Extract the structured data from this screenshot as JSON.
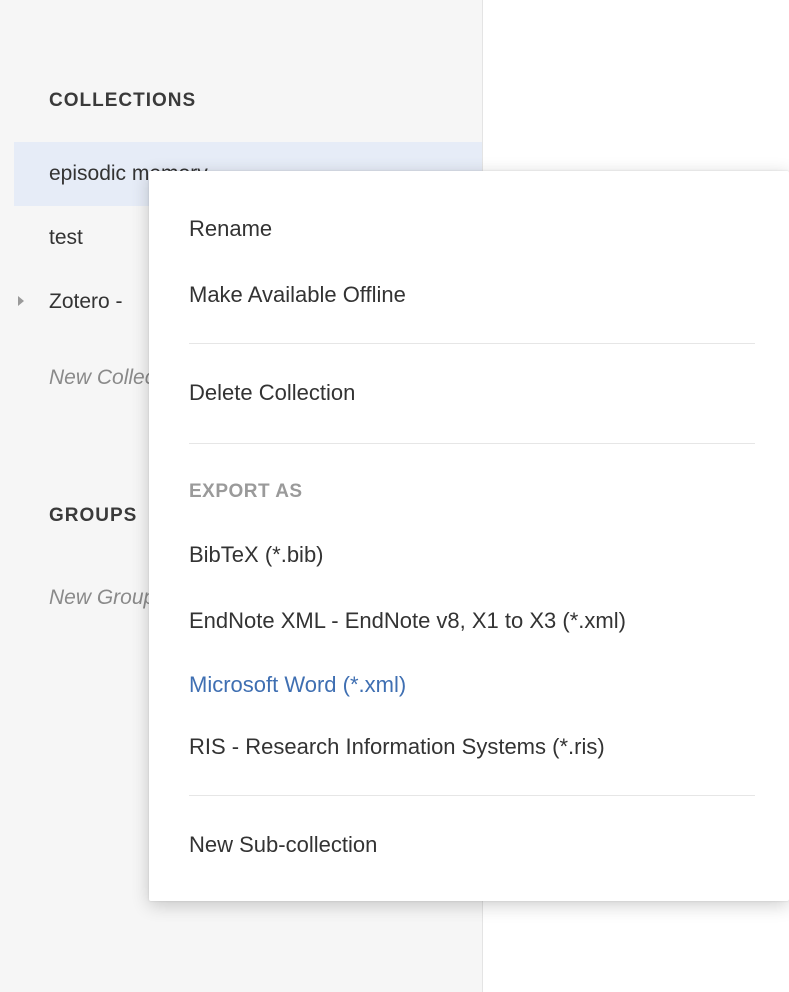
{
  "sidebar": {
    "collections_heading": "COLLECTIONS",
    "collections": [
      {
        "label": "episodic memory",
        "selected": true
      },
      {
        "label": "test"
      },
      {
        "label": "Zotero - ",
        "has_children": true
      },
      {
        "label": "New Collection"
      }
    ],
    "groups_heading": "GROUPS",
    "groups_placeholder": "New Group"
  },
  "context_menu": {
    "rename": "Rename",
    "make_offline": "Make Available Offline",
    "delete_collection": "Delete Collection",
    "export_heading": "EXPORT AS",
    "export_options": [
      "BibTeX (*.bib)",
      "EndNote XML - EndNote v8, X1 to X3 (*.xml)",
      "Microsoft Word (*.xml)",
      "RIS - Research Information Systems (*.ris)"
    ],
    "new_subcollection": "New Sub-collection",
    "active_color": "#3f6fb2"
  }
}
